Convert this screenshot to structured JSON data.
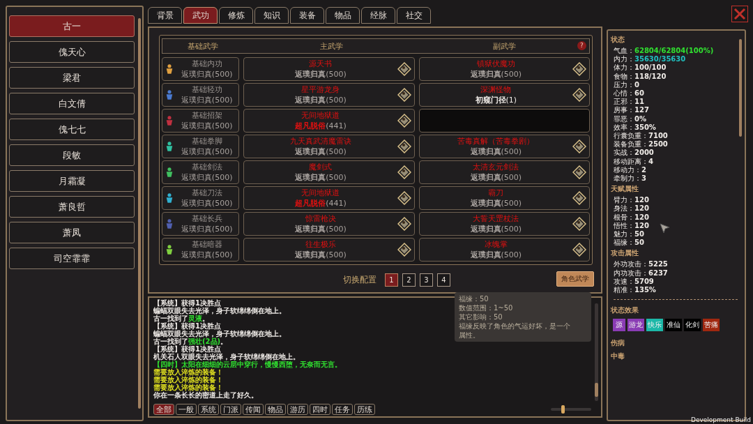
{
  "characters": [
    {
      "name": "古一",
      "selected": true
    },
    {
      "name": "傀天心",
      "selected": false
    },
    {
      "name": "梁君",
      "selected": false
    },
    {
      "name": "白文倩",
      "selected": false
    },
    {
      "name": "傀七七",
      "selected": false
    },
    {
      "name": "段敏",
      "selected": false
    },
    {
      "name": "月霜凝",
      "selected": false
    },
    {
      "name": "萧良哲",
      "selected": false
    },
    {
      "name": "萧凤",
      "selected": false
    },
    {
      "name": "司空霏霏",
      "selected": false
    }
  ],
  "tabs": [
    {
      "label": "背景",
      "selected": false
    },
    {
      "label": "武功",
      "selected": true
    },
    {
      "label": "修炼",
      "selected": false
    },
    {
      "label": "知识",
      "selected": false
    },
    {
      "label": "装备",
      "selected": false
    },
    {
      "label": "物品",
      "selected": false
    },
    {
      "label": "经脉",
      "selected": false
    },
    {
      "label": "社交",
      "selected": false
    }
  ],
  "table": {
    "columns": [
      "基础武学",
      "主武学",
      "副武学"
    ],
    "help": "?",
    "rows": [
      {
        "basic": {
          "name": "基础内功",
          "rank": "返璞归真",
          "count": "(500)",
          "color": "#e0a040"
        },
        "main": {
          "kind": "skill",
          "name": "源天书",
          "rank": "返璞归真",
          "count": "(500)",
          "color": "#a8a29e"
        },
        "sub": {
          "kind": "skill",
          "name": "镇狱伏魔功",
          "rank": "返璞归真",
          "count": "(500)",
          "color": "#a8a29e"
        }
      },
      {
        "basic": {
          "name": "基础轻功",
          "rank": "返璞归真",
          "count": "(500)",
          "color": "#4a7ad0"
        },
        "main": {
          "kind": "skill",
          "name": "星平游龙身",
          "rank": "返璞归真",
          "count": "(500)",
          "color": "#a8a29e"
        },
        "sub": {
          "kind": "skill",
          "name": "深渊怪物",
          "rank": "初窥门径",
          "count": "(1)",
          "color": "#f0ece8"
        }
      },
      {
        "basic": {
          "name": "基础招架",
          "rank": "返璞归真",
          "count": "(500)",
          "color": "#c03040"
        },
        "main": {
          "kind": "skill",
          "name": "无间地狱道",
          "rank": "超凡脱俗",
          "count": "(441)",
          "color": "#e01010"
        },
        "sub": {
          "kind": "empty"
        }
      },
      {
        "basic": {
          "name": "基础拳脚",
          "rank": "返璞归真",
          "count": "(500)",
          "color": "#30c0a0"
        },
        "main": {
          "kind": "skill",
          "name": "九天真武清魔雷诀",
          "rank": "返璞归真",
          "count": "(500)",
          "color": "#a8a29e"
        },
        "sub": {
          "kind": "skill",
          "name": "苦毒真解（苦毒拳剧）",
          "rank": "返璞归真",
          "count": "(500)",
          "color": "#a8a29e"
        }
      },
      {
        "basic": {
          "name": "基础剑法",
          "rank": "返璞归真",
          "count": "(500)",
          "color": "#40c060"
        },
        "main": {
          "kind": "skill",
          "name": "魔剑式",
          "rank": "返璞归真",
          "count": "(500)",
          "color": "#a8a29e"
        },
        "sub": {
          "kind": "skill",
          "name": "太清玄元剑法",
          "rank": "返璞归真",
          "count": "(500)",
          "color": "#a8a29e"
        }
      },
      {
        "basic": {
          "name": "基础刀法",
          "rank": "返璞归真",
          "count": "(500)",
          "color": "#30b0d0"
        },
        "main": {
          "kind": "skill",
          "name": "无间地狱道",
          "rank": "超凡脱俗",
          "count": "(441)",
          "color": "#e01010"
        },
        "sub": {
          "kind": "skill",
          "name": "霸刀",
          "rank": "返璞归真",
          "count": "(500)",
          "color": "#a8a29e"
        }
      },
      {
        "basic": {
          "name": "基础长兵",
          "rank": "返璞归真",
          "count": "(500)",
          "color": "#5060b0"
        },
        "main": {
          "kind": "skill",
          "name": "惊雷枪决",
          "rank": "返璞归真",
          "count": "(500)",
          "color": "#a8a29e"
        },
        "sub": {
          "kind": "skill",
          "name": "大誓天罡杖法",
          "rank": "返璞归真",
          "count": "(500)",
          "color": "#a8a29e"
        }
      },
      {
        "basic": {
          "name": "基础暗器",
          "rank": "返璞归真",
          "count": "(500)",
          "color": "#80d040"
        },
        "main": {
          "kind": "skill",
          "name": "往生极乐",
          "rank": "返璞归真",
          "count": "(500)",
          "color": "#a8a29e"
        },
        "sub": {
          "kind": "skill",
          "name": "冰魄掌",
          "rank": "返璞归真",
          "count": "(500)",
          "color": "#a8a29e"
        }
      }
    ]
  },
  "config": {
    "label": "切换配置",
    "pages": [
      {
        "label": "1",
        "selected": true
      },
      {
        "label": "2",
        "selected": false
      },
      {
        "label": "3",
        "selected": false
      },
      {
        "label": "4",
        "selected": false
      }
    ]
  },
  "role_button": "角色武学",
  "tooltip": [
    "福缘：50",
    "数值范围：1~50",
    "其它影响：50",
    "福缘反映了角色的气运好坏，是一个",
    "属性。"
  ],
  "log": {
    "lines": [
      [
        {
          "text": "【系统】获得1决胜点",
          "color": "#f0ece8"
        }
      ],
      [
        {
          "text": "蝙蝠双眼失去光泽，身子软绵绵倒在地上。",
          "color": "#f0ece8"
        }
      ],
      [
        {
          "text": "古一找到了",
          "color": "#f0ece8"
        },
        {
          "text": "灵液",
          "color": "#30e030"
        },
        {
          "text": "。"
        }
      ],
      [
        {
          "text": "【系统】获得1决胜点",
          "color": "#f0ece8"
        }
      ],
      [
        {
          "text": "蝙蝠双眼失去光泽，身子软绵绵倒在地上。",
          "color": "#f0ece8"
        }
      ],
      [
        {
          "text": "古一找到了",
          "color": "#f0ece8"
        },
        {
          "text": "强壮(2品)",
          "color": "#30e030"
        },
        {
          "text": "。"
        }
      ],
      [
        {
          "text": "【系统】获得1决胜点",
          "color": "#f0ece8"
        }
      ],
      [
        {
          "text": "机关石人双眼失去光泽，身子软绵绵倒在地上。",
          "color": "#f0ece8"
        }
      ],
      [
        {
          "text": "【四时】太阳在细细的云层中穿行，慢慢西堕，无奈而无言。",
          "color": "#30e030"
        }
      ],
      [
        {
          "text": "需要放入淬炼的装备！",
          "color": "#e0e020"
        }
      ],
      [
        {
          "text": "需要放入淬炼的装备！",
          "color": "#e0e020"
        }
      ],
      [
        {
          "text": "需要放入淬炼的装备！",
          "color": "#e0e020"
        }
      ],
      [
        {
          "text": "你在一条长长的密道上走了好久。",
          "color": "#f0ece8"
        }
      ]
    ],
    "filters": [
      {
        "label": "全部",
        "selected": true
      },
      {
        "label": "一般",
        "selected": false
      },
      {
        "label": "系统",
        "selected": false
      },
      {
        "label": "门派",
        "selected": false
      },
      {
        "label": "传闻",
        "selected": false
      },
      {
        "label": "物品",
        "selected": false
      },
      {
        "label": "游历",
        "selected": false
      },
      {
        "label": "四时",
        "selected": false
      },
      {
        "label": "任务",
        "selected": false
      },
      {
        "label": "历练",
        "selected": false
      }
    ],
    "zoom": {
      "level": 0.3
    }
  },
  "stats": {
    "sections": [
      {
        "title": "状态",
        "items": [
          {
            "label": "气血：",
            "value": "62804/62804(100%)",
            "color": "#30e030"
          },
          {
            "label": "内力：",
            "value": "35630/35630",
            "color": "#20c0c0"
          },
          {
            "label": "体力：",
            "value": "100/100",
            "color": "#f0ece8"
          },
          {
            "label": "食物：",
            "value": "118/120",
            "color": "#f0ece8"
          },
          {
            "label": "压力：",
            "value": "0",
            "color": "#f0ece8"
          },
          {
            "label": "心情：",
            "value": "60",
            "color": "#f0ece8"
          },
          {
            "label": "正邪：",
            "value": "11",
            "color": "#f0ece8"
          },
          {
            "label": "房事：",
            "value": "127",
            "color": "#f0ece8"
          },
          {
            "label": "罪恶：",
            "value": "0%",
            "color": "#f0ece8"
          },
          {
            "label": "效率：",
            "value": "350%",
            "color": "#f0ece8"
          },
          {
            "label": "行囊负重：",
            "value": "7100",
            "color": "#f0ece8"
          },
          {
            "label": "装备负重：",
            "value": "2500",
            "color": "#f0ece8"
          },
          {
            "label": "实战：",
            "value": "2000",
            "color": "#f0ece8"
          },
          {
            "label": "移动距离：",
            "value": "4",
            "color": "#f0ece8"
          },
          {
            "label": "移动力：",
            "value": "2",
            "color": "#f0ece8"
          },
          {
            "label": "牵制力：",
            "value": "3",
            "color": "#f0ece8"
          }
        ]
      },
      {
        "title": "天赋属性",
        "items": [
          {
            "label": "臂力：",
            "value": "120",
            "color": "#f0ece8"
          },
          {
            "label": "身法：",
            "value": "120",
            "color": "#f0ece8"
          },
          {
            "label": "根骨：",
            "value": "120",
            "color": "#f0ece8"
          },
          {
            "label": "悟性：",
            "value": "120",
            "color": "#f0ece8"
          },
          {
            "label": "魅力：",
            "value": "50",
            "color": "#f0ece8"
          },
          {
            "label": "福缘：",
            "value": "50",
            "color": "#f0ece8"
          }
        ]
      },
      {
        "title": "攻击属性",
        "items": [
          {
            "label": "外功攻击：",
            "value": "5225",
            "color": "#f0ece8"
          },
          {
            "label": "内功攻击：",
            "value": "6237",
            "color": "#f0ece8"
          },
          {
            "label": "攻速：",
            "value": "5709",
            "color": "#f0ece8"
          },
          {
            "label": "精准：",
            "value": "135%",
            "color": "#f0ece8"
          }
        ]
      }
    ],
    "effects_title": "状态效果",
    "effects": [
      {
        "label": "源",
        "color": "#8a3cb4"
      },
      {
        "label": "游龙",
        "color": "#8a3cb4"
      },
      {
        "label": "快乐",
        "color": "#1cb8a8"
      },
      {
        "label": "准仙",
        "color": "#000000"
      },
      {
        "label": "化剑",
        "color": "#000000"
      },
      {
        "label": "苦痛",
        "color": "#a02810"
      }
    ],
    "injury_title": "伤病",
    "poison_title": "中毒"
  },
  "build_label": "Development Build"
}
